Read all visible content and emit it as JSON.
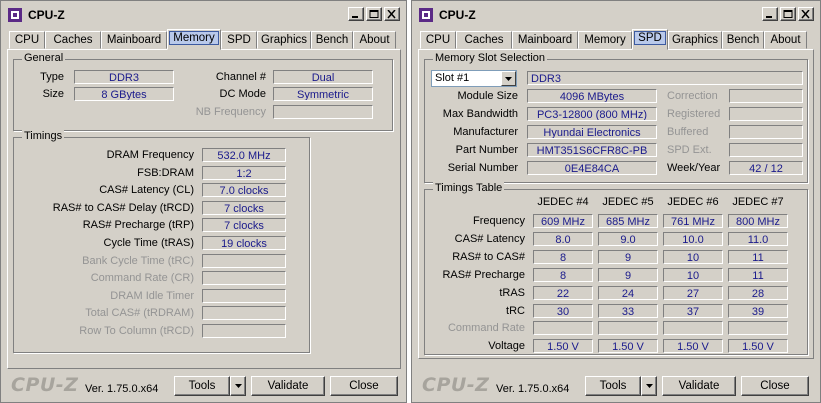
{
  "window1": {
    "title": "CPU-Z",
    "tabs": [
      "CPU",
      "Caches",
      "Mainboard",
      "Memory",
      "SPD",
      "Graphics",
      "Bench",
      "About"
    ],
    "active_tab": "Memory",
    "general": {
      "title": "General",
      "type_label": "Type",
      "type_value": "DDR3",
      "size_label": "Size",
      "size_value": "8 GBytes",
      "channel_label": "Channel #",
      "channel_value": "Dual",
      "dcmode_label": "DC Mode",
      "dcmode_value": "Symmetric",
      "nbfreq_label": "NB Frequency",
      "nbfreq_value": ""
    },
    "timings": {
      "title": "Timings",
      "rows": [
        {
          "label": "DRAM Frequency",
          "value": "532.0 MHz",
          "enabled": true
        },
        {
          "label": "FSB:DRAM",
          "value": "1:2",
          "enabled": true
        },
        {
          "label": "CAS# Latency (CL)",
          "value": "7.0 clocks",
          "enabled": true
        },
        {
          "label": "RAS# to CAS# Delay (tRCD)",
          "value": "7 clocks",
          "enabled": true
        },
        {
          "label": "RAS# Precharge (tRP)",
          "value": "7 clocks",
          "enabled": true
        },
        {
          "label": "Cycle Time (tRAS)",
          "value": "19 clocks",
          "enabled": true
        },
        {
          "label": "Bank Cycle Time (tRC)",
          "value": "",
          "enabled": false
        },
        {
          "label": "Command Rate (CR)",
          "value": "",
          "enabled": false
        },
        {
          "label": "DRAM Idle Timer",
          "value": "",
          "enabled": false
        },
        {
          "label": "Total CAS# (tRDRAM)",
          "value": "",
          "enabled": false
        },
        {
          "label": "Row To Column (tRCD)",
          "value": "",
          "enabled": false
        }
      ]
    },
    "footer": {
      "logo": "CPU-Z",
      "version": "Ver. 1.75.0.x64",
      "tools": "Tools",
      "validate": "Validate",
      "close": "Close"
    }
  },
  "window2": {
    "title": "CPU-Z",
    "tabs": [
      "CPU",
      "Caches",
      "Mainboard",
      "Memory",
      "SPD",
      "Graphics",
      "Bench",
      "About"
    ],
    "active_tab": "SPD",
    "slot": {
      "title": "Memory Slot Selection",
      "selected": "Slot #1",
      "type_value": "DDR3",
      "module_size_label": "Module Size",
      "module_size_value": "4096 MBytes",
      "max_bw_label": "Max Bandwidth",
      "max_bw_value": "PC3-12800 (800 MHz)",
      "manufacturer_label": "Manufacturer",
      "manufacturer_value": "Hyundai Electronics",
      "part_label": "Part Number",
      "part_value": "HMT351S6CFR8C-PB",
      "serial_label": "Serial Number",
      "serial_value": "0E4E84CA",
      "correction_label": "Correction",
      "correction_value": "",
      "registered_label": "Registered",
      "registered_value": "",
      "buffered_label": "Buffered",
      "buffered_value": "",
      "spdext_label": "SPD Ext.",
      "spdext_value": "",
      "weekyear_label": "Week/Year",
      "weekyear_value": "42 / 12"
    },
    "timings_table": {
      "title": "Timings Table",
      "columns": [
        "JEDEC #4",
        "JEDEC #5",
        "JEDEC #6",
        "JEDEC #7"
      ],
      "rows": [
        {
          "label": "Frequency",
          "enabled": true,
          "values": [
            "609 MHz",
            "685 MHz",
            "761 MHz",
            "800 MHz"
          ]
        },
        {
          "label": "CAS# Latency",
          "enabled": true,
          "values": [
            "8.0",
            "9.0",
            "10.0",
            "11.0"
          ]
        },
        {
          "label": "RAS# to CAS#",
          "enabled": true,
          "values": [
            "8",
            "9",
            "10",
            "11"
          ]
        },
        {
          "label": "RAS# Precharge",
          "enabled": true,
          "values": [
            "8",
            "9",
            "10",
            "11"
          ]
        },
        {
          "label": "tRAS",
          "enabled": true,
          "values": [
            "22",
            "24",
            "27",
            "28"
          ]
        },
        {
          "label": "tRC",
          "enabled": true,
          "values": [
            "30",
            "33",
            "37",
            "39"
          ]
        },
        {
          "label": "Command Rate",
          "enabled": false,
          "values": [
            "",
            "",
            "",
            ""
          ]
        },
        {
          "label": "Voltage",
          "enabled": true,
          "values": [
            "1.50 V",
            "1.50 V",
            "1.50 V",
            "1.50 V"
          ]
        }
      ]
    },
    "footer": {
      "logo": "CPU-Z",
      "version": "Ver. 1.75.0.x64",
      "tools": "Tools",
      "validate": "Validate",
      "close": "Close"
    }
  },
  "colors": {
    "value_text": "#1a1a8c",
    "disabled_text": "#949494",
    "active_tab_bg": "#b9c9ea",
    "window_bg": "#d4d0c8"
  }
}
